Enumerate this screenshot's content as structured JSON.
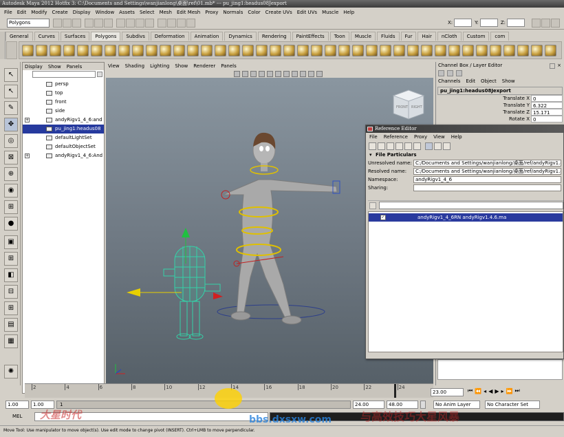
{
  "title": "Autodesk Maya 2012 Hotfix 3: C:\\Documents and Settings\\wanjianlong\\桌面\\ref\\01.mb* --- pu_jing1:headus08Jexport",
  "menus": [
    "File",
    "Edit",
    "Modify",
    "Create",
    "Display",
    "Window",
    "Assets",
    "Select",
    "Mesh",
    "Edit Mesh",
    "Proxy",
    "Normals",
    "Color",
    "Create UVs",
    "Edit UVs",
    "Muscle",
    "Help"
  ],
  "menu_set": "Polygons",
  "coord_labels": {
    "x": "X:",
    "y": "Y:",
    "z": "Z:"
  },
  "shelf_tabs": [
    "General",
    "Curves",
    "Surfaces",
    "Polygons",
    "Subdivs",
    "Deformation",
    "Animation",
    "Dynamics",
    "Rendering",
    "PaintEffects",
    "Toon",
    "Muscle",
    "Fluids",
    "Fur",
    "Hair",
    "nCloth",
    "Custom",
    "com"
  ],
  "active_shelf": "Polygons",
  "outliner": {
    "menu": [
      "Display",
      "Show",
      "Panels"
    ],
    "items": [
      {
        "label": "persp",
        "selected": false,
        "expandable": false
      },
      {
        "label": "top",
        "selected": false,
        "expandable": false
      },
      {
        "label": "front",
        "selected": false,
        "expandable": false
      },
      {
        "label": "side",
        "selected": false,
        "expandable": false
      },
      {
        "label": "andyRigv1_4_6:and",
        "selected": false,
        "expandable": true
      },
      {
        "label": "pu_jing1:headus08",
        "selected": true,
        "expandable": false
      },
      {
        "label": "defaultLightSet",
        "selected": false,
        "expandable": false
      },
      {
        "label": "defaultObjectSet",
        "selected": false,
        "expandable": false
      },
      {
        "label": "andyRigv1_4_6:And",
        "selected": false,
        "expandable": true
      }
    ]
  },
  "viewport_menu": [
    "View",
    "Shading",
    "Lighting",
    "Show",
    "Renderer",
    "Panels"
  ],
  "viewcube": {
    "front": "FRONT",
    "right": "RIGHT"
  },
  "timeline": {
    "ticks": [
      "2",
      "4",
      "6",
      "8",
      "10",
      "12",
      "14",
      "16",
      "18",
      "20",
      "22",
      "24"
    ]
  },
  "channel_box": {
    "title": "Channel Box / Layer Editor",
    "menu": [
      "Channels",
      "Edit",
      "Object",
      "Show"
    ],
    "object": "pu_jing1:headus08Jexport",
    "attributes": [
      {
        "label": "Translate X",
        "value": "0"
      },
      {
        "label": "Translate Y",
        "value": "6.322"
      },
      {
        "label": "Translate Z",
        "value": "15.171"
      },
      {
        "label": "Rotate X",
        "value": "0"
      }
    ]
  },
  "reference_editor": {
    "title": "Reference Editor",
    "menu": [
      "File",
      "Reference",
      "Proxy",
      "View",
      "Help"
    ],
    "section": "File Particulars",
    "fields": [
      {
        "label": "Unresolved name:",
        "value": "C:/Documents and Settings/wanjianlong/桌面/ref/andyRigv1.4.6.ma"
      },
      {
        "label": "Resolved name:",
        "value": "C:/Documents and Settings/wanjianlong/桌面/ref/andyRigv1.4.6.ma"
      },
      {
        "label": "Namespace:",
        "value": "andyRigv1_4_6"
      },
      {
        "label": "Sharing:",
        "value": ""
      }
    ],
    "reference_item": "andyRigv1_4_6RN andyRigv1.4.6.ma",
    "reference_checked": true
  },
  "range": {
    "start": "1.00",
    "inner_start": "1.00",
    "inner_end": "24.00",
    "end": "48.00",
    "current": "23.00",
    "inner_marker": "1"
  },
  "anim_layer": "No Anim Layer",
  "character_set": "No Character Set",
  "cmd_label": "MEL",
  "help_line": "Move Tool: Use manipulator to move object(s). Use edit mode to change pivot (INSERT). Ctrl+LMB to move perpendicular.",
  "watermark": {
    "url": "bbs.dxsxw.com",
    "cn": "与高效技巧大星风暴",
    "brand": "大星时代"
  }
}
